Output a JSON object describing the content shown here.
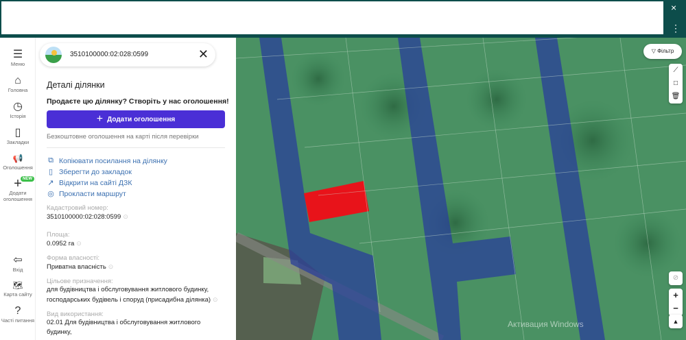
{
  "topbar": {
    "close_icon": "×",
    "menu_icon": "⋮"
  },
  "rail": [
    {
      "icon": "☰",
      "label": "Меню"
    },
    {
      "icon": "⌂",
      "label": "Головна"
    },
    {
      "icon": "◷",
      "label": "Історія"
    },
    {
      "icon": "▯",
      "label": "Закладки"
    },
    {
      "icon": "📢",
      "label": "Оголошення"
    },
    {
      "icon": "+",
      "label": "Додати оголошення",
      "badge": "NEW"
    },
    {
      "icon": "⇦",
      "label": "Вхід"
    },
    {
      "icon": "🗺",
      "label": "Карта сайту"
    },
    {
      "icon": "?",
      "label": "Часті питання"
    }
  ],
  "search": {
    "value": "3510100000:02:028:0599"
  },
  "panel": {
    "title": "Деталі ділянки",
    "promo": "Продаєте цю ділянку? Створіть у нас оголошення!",
    "add_button": "Додати оголошення",
    "free_note": "Безкоштовне оголошення на карті після перевірки",
    "actions": [
      {
        "icon": "⧉",
        "label": "Копіювати посилання на ділянку"
      },
      {
        "icon": "▯",
        "label": "Зберегти до закладок"
      },
      {
        "icon": "↗",
        "label": "Відкрити на сайті ДЗК"
      },
      {
        "icon": "◎",
        "label": "Прокласти маршрут"
      }
    ],
    "fields": [
      {
        "label": "Кадастровий номер:",
        "value": "3510100000:02:028:0599"
      },
      {
        "label": "Площа:",
        "value": "0.0952 га"
      },
      {
        "label": "Форма власності:",
        "value": "Приватна власність"
      },
      {
        "label": "Цільове призначення:",
        "value": "для будівництва і обслуговування житлового будинку, господарських будівель і споруд (присадибна ділянка)"
      },
      {
        "label": "Вид використання:",
        "value": "02.01 Для будівництва і обслуговування житлового будинку,"
      }
    ]
  },
  "map": {
    "filter": "Фільтр",
    "watermark": "Активация Windows",
    "parcel_color": "#e8131a",
    "zone_color": "#2a3f9a"
  }
}
